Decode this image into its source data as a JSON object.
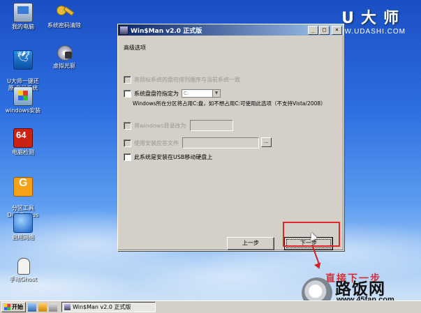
{
  "desktop": {
    "icons": [
      {
        "label": "我的电脑"
      },
      {
        "label": "系统密码清除"
      },
      {
        "label": "U大师一键还\n原·备份系统"
      },
      {
        "label": "虚拟光驱"
      },
      {
        "label": "windows安装"
      },
      {
        "label": "电脑检测"
      },
      {
        "label": "分区工具\nDiskGenius"
      },
      {
        "label": "启用网络"
      },
      {
        "label": "手动Ghost"
      }
    ],
    "brand": {
      "big": "U大师",
      "url": "WWW.UDASHI.COM"
    }
  },
  "window": {
    "title": "Win$Man v2.0 正式版",
    "title_buttons": {
      "minimize": "_",
      "maximize": "□",
      "close": "×"
    },
    "section_title": "高级选项",
    "options": {
      "opt1": "将目标系统的盘符排列顺序与当前系统一致",
      "opt2": "系统盘盘符指定为",
      "opt2_combo": "C:",
      "opt2_note": "Windows所在分区将占用C:盘，如不想占用C:可使用此选项（不支持Vista/2008）",
      "opt3": "将windows目录改为",
      "opt4": "使用安装应答文件",
      "opt4_browse": "...",
      "opt5": "此系统是安装在USB移动硬盘上"
    },
    "buttons": {
      "prev": "上一步",
      "next": "下一步"
    }
  },
  "annotation": {
    "hint": "直接下一步"
  },
  "watermark": {
    "text": "路饭网",
    "url": "www.45fan.com"
  },
  "taskbar": {
    "start": "开始",
    "task": "Win$Man v2.0 正式版"
  }
}
